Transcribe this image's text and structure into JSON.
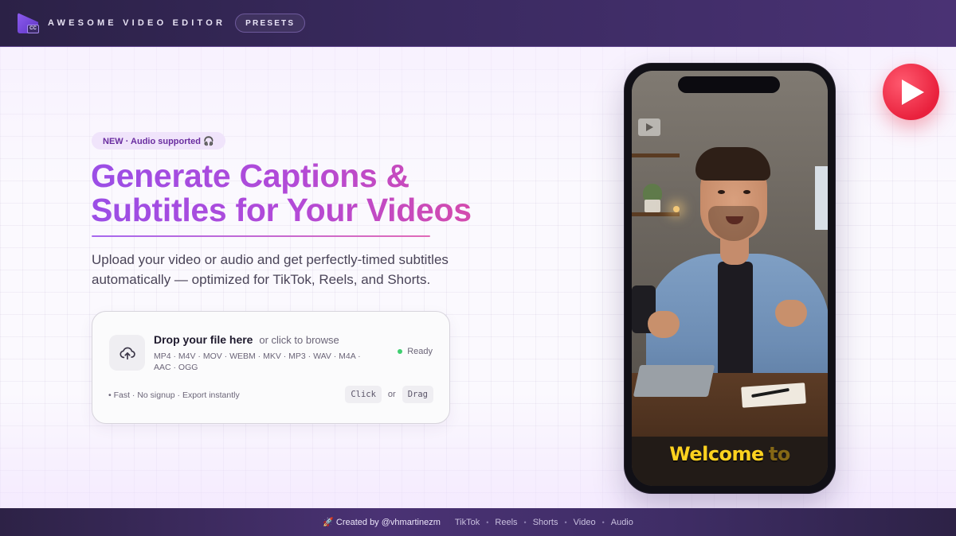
{
  "header": {
    "brand": "AWESOME VIDEO EDITOR",
    "presets_label": "PRESETS",
    "logo_badge": "CC"
  },
  "hero": {
    "badge": "NEW · Audio supported 🎧",
    "headline_line1": "Generate Captions &",
    "headline_line2": "Subtitles for Your Videos",
    "subtitle_line1": "Upload your video or audio and get perfectly-timed subtitles",
    "subtitle_line2": "automatically — optimized for TikTok, Reels, and Shorts."
  },
  "upload": {
    "title": "Drop your file here",
    "hint": "or click to browse",
    "formats_line1": "MP4 · M4V · MOV · WEBM · MKV · MP3 · WAV · M4A ·",
    "formats_line2": "AAC · OGG",
    "status": "Ready",
    "status_color": "#3fcf70",
    "perks": "• Fast · No signup · Export instantly",
    "click_label": "Click",
    "or_label": "or",
    "drag_label": "Drag",
    "icon": "cloud-upload-icon"
  },
  "preview": {
    "caption_active": "Welcome",
    "caption_next": "to",
    "caption_color": "#ffd21f"
  },
  "play_badge": {
    "icon": "play-icon",
    "color": "#e9213d"
  },
  "footer": {
    "credit": "🚀 Created by @vhmartinezm",
    "links": [
      "TikTok",
      "Reels",
      "Shorts",
      "Video",
      "Audio"
    ],
    "separator": "•"
  },
  "colors": {
    "accent_purple": "#9b4ee6",
    "accent_pink": "#e04b9e",
    "topbar_bg": "#2b2146"
  }
}
